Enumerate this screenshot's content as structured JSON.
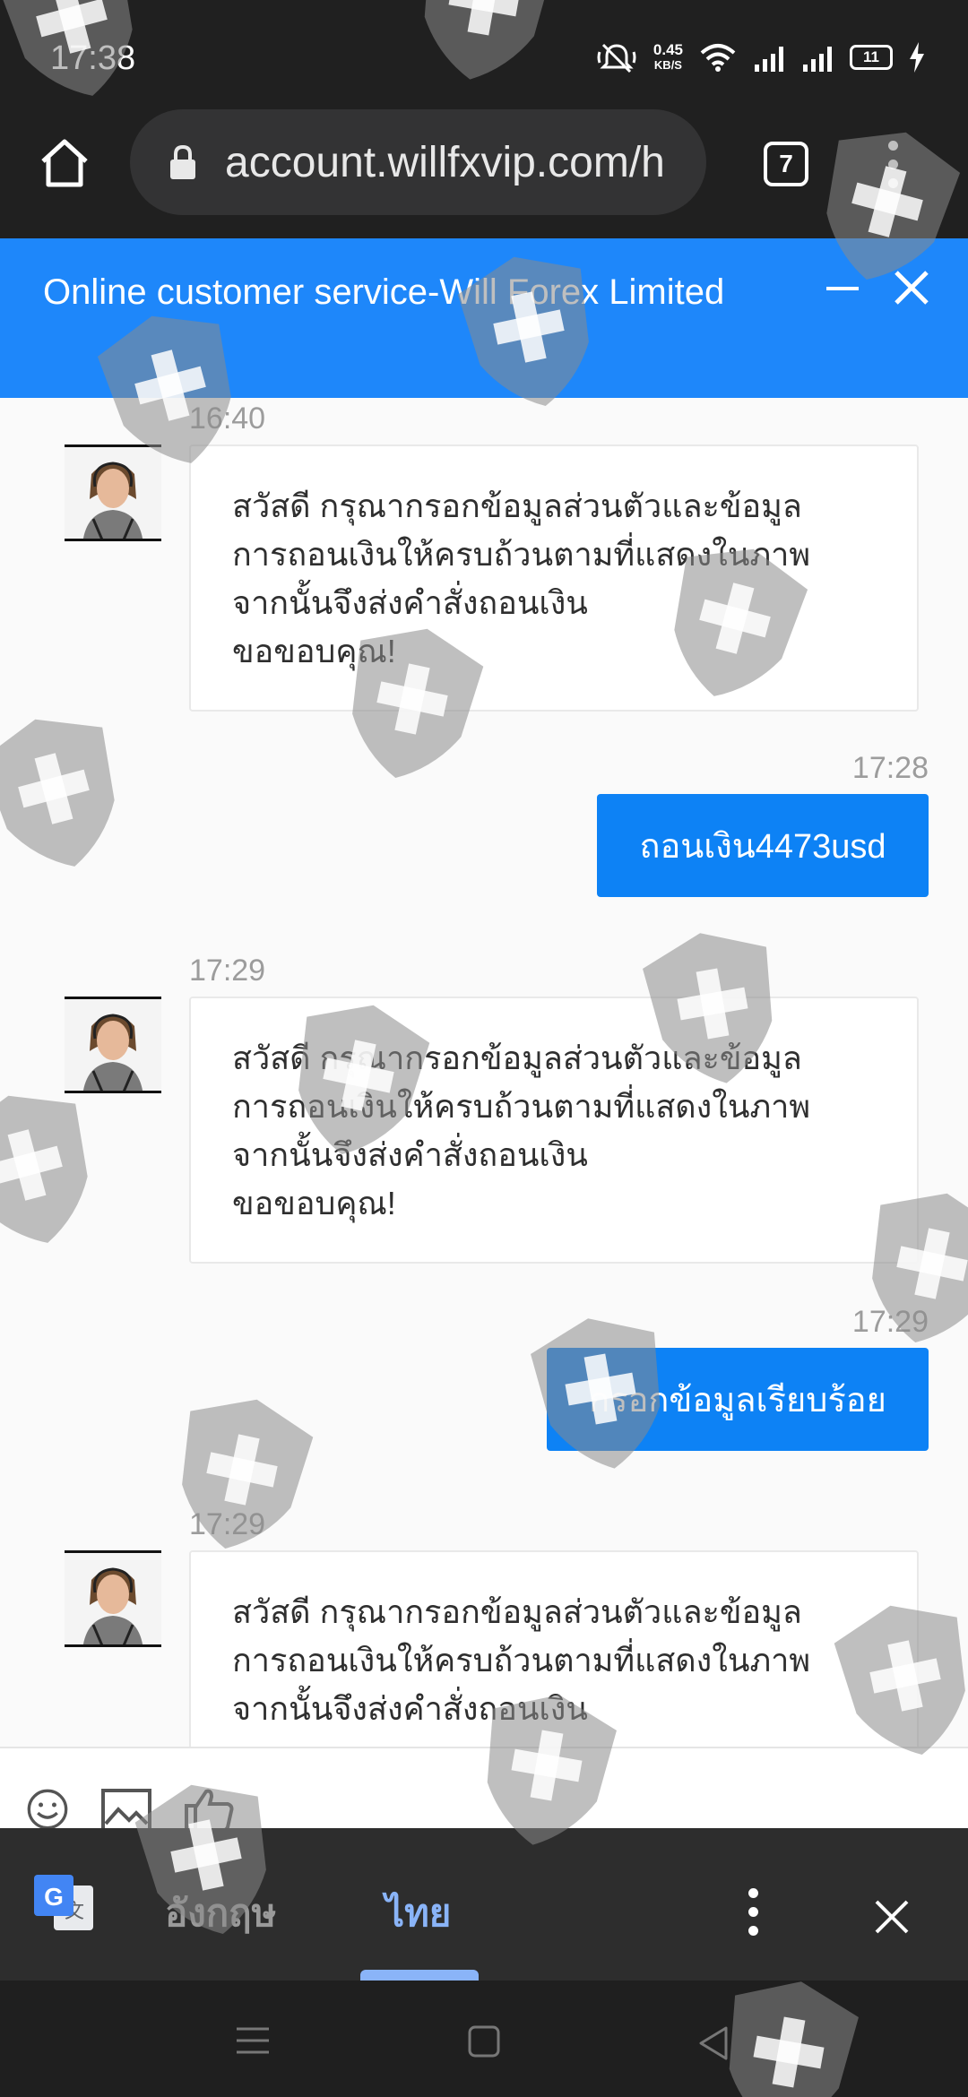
{
  "status_bar": {
    "time": "17:38",
    "net_speed_value": "0.45",
    "net_speed_unit": "KB/S",
    "battery": "11"
  },
  "browser": {
    "url": "account.willfxvip.com/h",
    "tab_count": "7"
  },
  "chat": {
    "title": "Online customer service-Will Forex Limited",
    "messages": [
      {
        "from": "agent",
        "time": "16:40",
        "lines": [
          "สวัสดี กรุณากรอกข้อมูลส่วนตัวและข้อมูล",
          "การถอนเงินให้ครบถ้วนตามที่แสดงในภาพ",
          "จากนั้นจึงส่งคำสั่งถอนเงิน",
          "ขอขอบคุณ!"
        ]
      },
      {
        "from": "user",
        "time": "17:28",
        "text": "ถอนเงิน4473usd"
      },
      {
        "from": "agent",
        "time": "17:29",
        "lines": [
          "สวัสดี กรุณากรอกข้อมูลส่วนตัวและข้อมูล",
          "การถอนเงินให้ครบถ้วนตามที่แสดงในภาพ",
          "จากนั้นจึงส่งคำสั่งถอนเงิน",
          "ขอขอบคุณ!"
        ]
      },
      {
        "from": "user",
        "time": "17:29",
        "text": "กรอกข้อมูลเรียบร้อย"
      },
      {
        "from": "agent",
        "time": "17:29",
        "lines": [
          "สวัสดี กรุณากรอกข้อมูลส่วนตัวและข้อมูล",
          "การถอนเงินให้ครบถ้วนตามที่แสดงในภาพ",
          "จากนั้นจึงส่งคำสั่งถอนเงิน"
        ]
      }
    ]
  },
  "translate_bar": {
    "source_lang": "อังกฤษ",
    "target_lang": "ไทย"
  },
  "colors": {
    "header_blue": "#1e87fa",
    "user_bubble_blue": "#0d82f5",
    "translate_accent": "#8ab4f8"
  }
}
